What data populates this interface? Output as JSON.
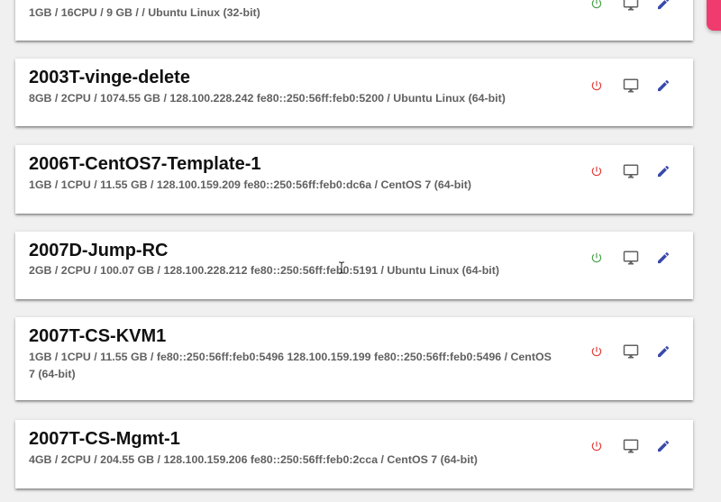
{
  "colors": {
    "power_on": "#43a047",
    "power_off": "#e53935",
    "console_icon": "#616161",
    "edit_icon": "#3949ab",
    "fab_accent": "#ef3b6e"
  },
  "vms": [
    {
      "name": "",
      "specs": "1GB / 16CPU / 9 GB / / Ubuntu Linux (32-bit)",
      "power_state": "on",
      "icons": [
        "power-icon",
        "monitor-icon",
        "pencil-icon"
      ]
    },
    {
      "name": "2003T-vinge-delete",
      "specs": "8GB / 2CPU / 1074.55 GB / 128.100.228.242 fe80::250:56ff:feb0:5200 / Ubuntu Linux (64-bit)",
      "power_state": "off",
      "icons": [
        "power-icon",
        "monitor-icon",
        "pencil-icon"
      ]
    },
    {
      "name": "2006T-CentOS7-Template-1",
      "specs": "1GB / 1CPU / 11.55 GB / 128.100.159.209 fe80::250:56ff:feb0:dc6a / CentOS 7 (64-bit)",
      "power_state": "off",
      "icons": [
        "power-icon",
        "monitor-icon",
        "pencil-icon"
      ]
    },
    {
      "name": "2007D-Jump-RC",
      "specs": "2GB / 2CPU / 100.07 GB / 128.100.228.212 fe80::250:56ff:feb0:5191 / Ubuntu Linux (64-bit)",
      "power_state": "on",
      "icons": [
        "power-icon",
        "monitor-icon",
        "pencil-icon"
      ]
    },
    {
      "name": "2007T-CS-KVM1",
      "specs": "1GB / 1CPU / 11.55 GB / fe80::250:56ff:feb0:5496 128.100.159.199 fe80::250:56ff:feb0:5496 / CentOS 7 (64-bit)",
      "power_state": "off",
      "icons": [
        "power-icon",
        "monitor-icon",
        "pencil-icon"
      ]
    },
    {
      "name": "2007T-CS-Mgmt-1",
      "specs": "4GB / 2CPU / 204.55 GB / 128.100.159.206 fe80::250:56ff:feb0:2cca / CentOS 7 (64-bit)",
      "power_state": "off",
      "icons": [
        "power-icon",
        "monitor-icon",
        "pencil-icon"
      ]
    }
  ]
}
